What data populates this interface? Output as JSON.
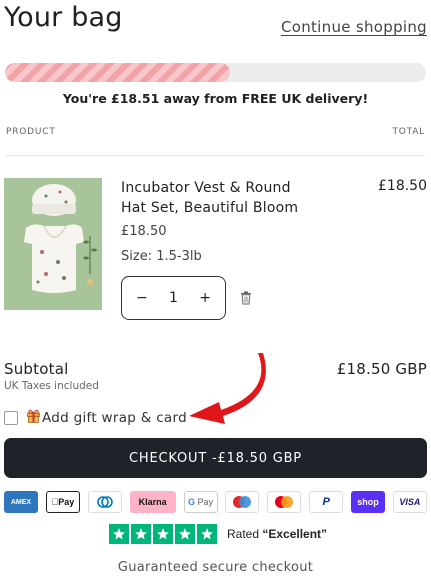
{
  "header": {
    "title": "Your bag",
    "continue_label": "Continue shopping"
  },
  "delivery": {
    "progress_fraction": 0.535,
    "message": "You're £18.51 away from FREE UK delivery!",
    "bar_color": "#f2a3a8"
  },
  "table": {
    "product_header": "PRODUCT",
    "total_header": "TOTAL"
  },
  "item": {
    "name": "Incubator Vest & Round Hat Set, Beautiful Bloom",
    "price": "£18.50",
    "size": "Size: 1.5-3lb",
    "quantity": "1",
    "decrease_label": "−",
    "increase_label": "+",
    "line_total": "£18.50",
    "image_color": "#a8c49a"
  },
  "summary": {
    "subtotal_label": "Subtotal",
    "taxes_label": "UK Taxes included",
    "subtotal_value": "£18.50 GBP"
  },
  "gift": {
    "label": "Add gift wrap & card",
    "checked": false
  },
  "checkout": {
    "label": "CHECKOUT -£18.50 GBP",
    "color": "#1f2228"
  },
  "payment_methods": [
    {
      "name": "AMEX",
      "icon": "amex-icon"
    },
    {
      "name": "Pay",
      "icon": "apple-pay-icon"
    },
    {
      "name": "Diners",
      "icon": "diners-club-icon"
    },
    {
      "name": "Klarna",
      "icon": "klarna-icon"
    },
    {
      "name": "G Pay",
      "icon": "google-pay-icon"
    },
    {
      "name": "Maestro",
      "icon": "maestro-icon"
    },
    {
      "name": "Mastercard",
      "icon": "mastercard-icon"
    },
    {
      "name": "PayPal",
      "icon": "paypal-icon"
    },
    {
      "name": "shop",
      "icon": "shop-pay-icon"
    },
    {
      "name": "VISA",
      "icon": "visa-icon"
    }
  ],
  "trustpilot": {
    "stars": 5,
    "rated_prefix": "Rated ",
    "rating_word": "“Excellent”",
    "color": "#00b67a"
  },
  "footer": {
    "secure_text": "Guaranteed secure checkout"
  }
}
